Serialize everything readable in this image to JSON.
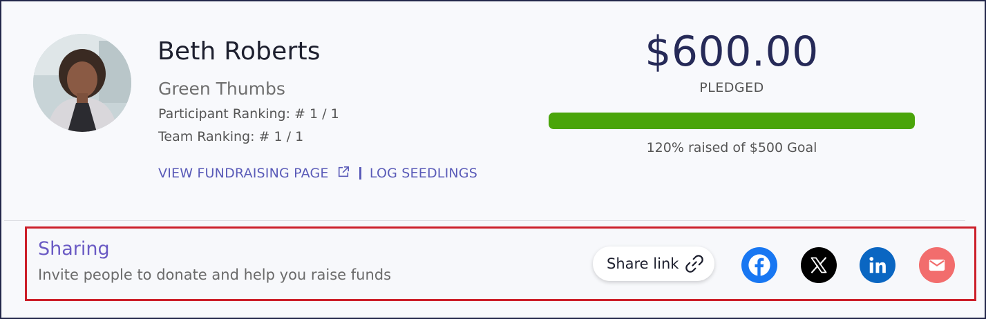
{
  "participant": {
    "name": "Beth Roberts",
    "team": "Green Thumbs",
    "participant_ranking": "Participant Ranking: # 1 / 1",
    "team_ranking": "Team Ranking: # 1 / 1"
  },
  "links": {
    "view_fundraising": "VIEW FUNDRAISING PAGE",
    "log_seedlings": "LOG SEEDLINGS"
  },
  "fundraising": {
    "amount": "$600.00",
    "status_label": "PLEDGED",
    "progress_percent": 120,
    "progress_text": "120% raised of $500 Goal"
  },
  "sharing": {
    "title": "Sharing",
    "subtitle": "Invite people to donate and help you raise funds",
    "share_link_label": "Share link",
    "icons": [
      "link-icon",
      "facebook-icon",
      "x-icon",
      "linkedin-icon",
      "email-icon"
    ]
  },
  "colors": {
    "accent": "#5a5bb8",
    "progress": "#4aa50a",
    "highlight_border": "#cc1f2a",
    "facebook": "#1877f2",
    "x": "#000000",
    "linkedin": "#0a66c2",
    "email": "#f26d6d"
  }
}
